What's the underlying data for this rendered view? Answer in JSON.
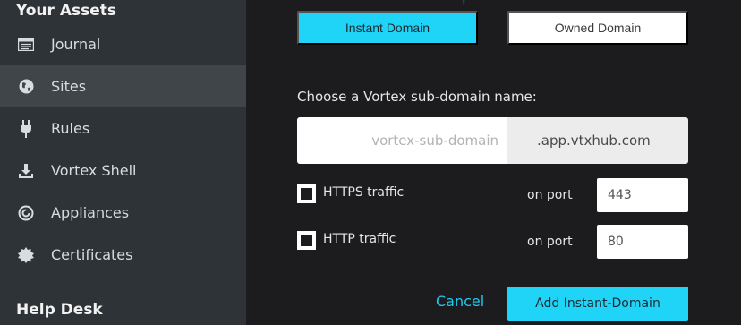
{
  "sidebar": {
    "assets_title": "Your Assets",
    "help_title": "Help Desk",
    "items": [
      {
        "label": "Journal",
        "icon": "journal-icon"
      },
      {
        "label": "Sites",
        "icon": "globe-icon",
        "active": true
      },
      {
        "label": "Rules",
        "icon": "plug-icon"
      },
      {
        "label": "Vortex Shell",
        "icon": "download-icon"
      },
      {
        "label": "Appliances",
        "icon": "appliance-icon"
      },
      {
        "label": "Certificates",
        "icon": "certificate-icon"
      }
    ]
  },
  "main": {
    "tabs": {
      "instant": "Instant Domain",
      "owned": "Owned Domain",
      "active": "instant"
    },
    "choose_label": "Choose a Vortex sub-domain name:",
    "subdomain": {
      "placeholder": "vortex-sub-domain",
      "value": "",
      "suffix": ".app.vtxhub.com"
    },
    "https": {
      "label": "HTTPS traffic",
      "port_label": "on port",
      "port": "443",
      "checked": false
    },
    "http": {
      "label": "HTTP traffic",
      "port_label": "on port",
      "port": "80",
      "checked": false
    },
    "cancel_label": "Cancel",
    "submit_label": "Add Instant-Domain"
  },
  "colors": {
    "accent": "#20d4f7",
    "sidebar_bg": "#2e3338",
    "sidebar_active": "#40454a",
    "main_bg": "#1c1c1e"
  }
}
